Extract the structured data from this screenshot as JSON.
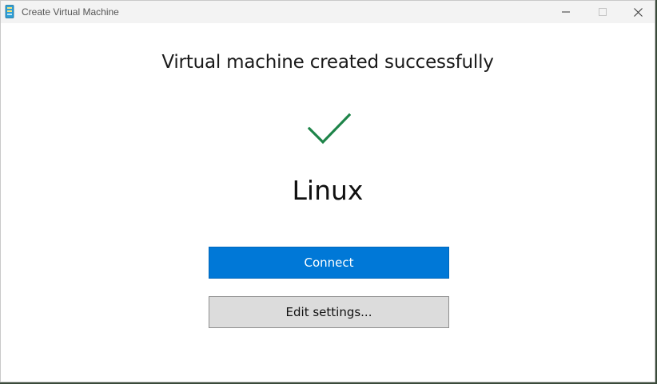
{
  "window": {
    "title": "Create Virtual Machine",
    "app_icon": "hyperv-vm-icon",
    "controls": {
      "minimize": "minimize-icon",
      "maximize": "maximize-icon",
      "close": "close-icon"
    }
  },
  "main": {
    "headline": "Virtual machine created successfully",
    "status_icon": "checkmark-icon",
    "vm_name": "Linux",
    "connect_label": "Connect",
    "edit_settings_label": "Edit settings..."
  },
  "colors": {
    "accent": "#0078d7",
    "success": "#1e8449",
    "secondary_button": "#dcdcdc"
  }
}
